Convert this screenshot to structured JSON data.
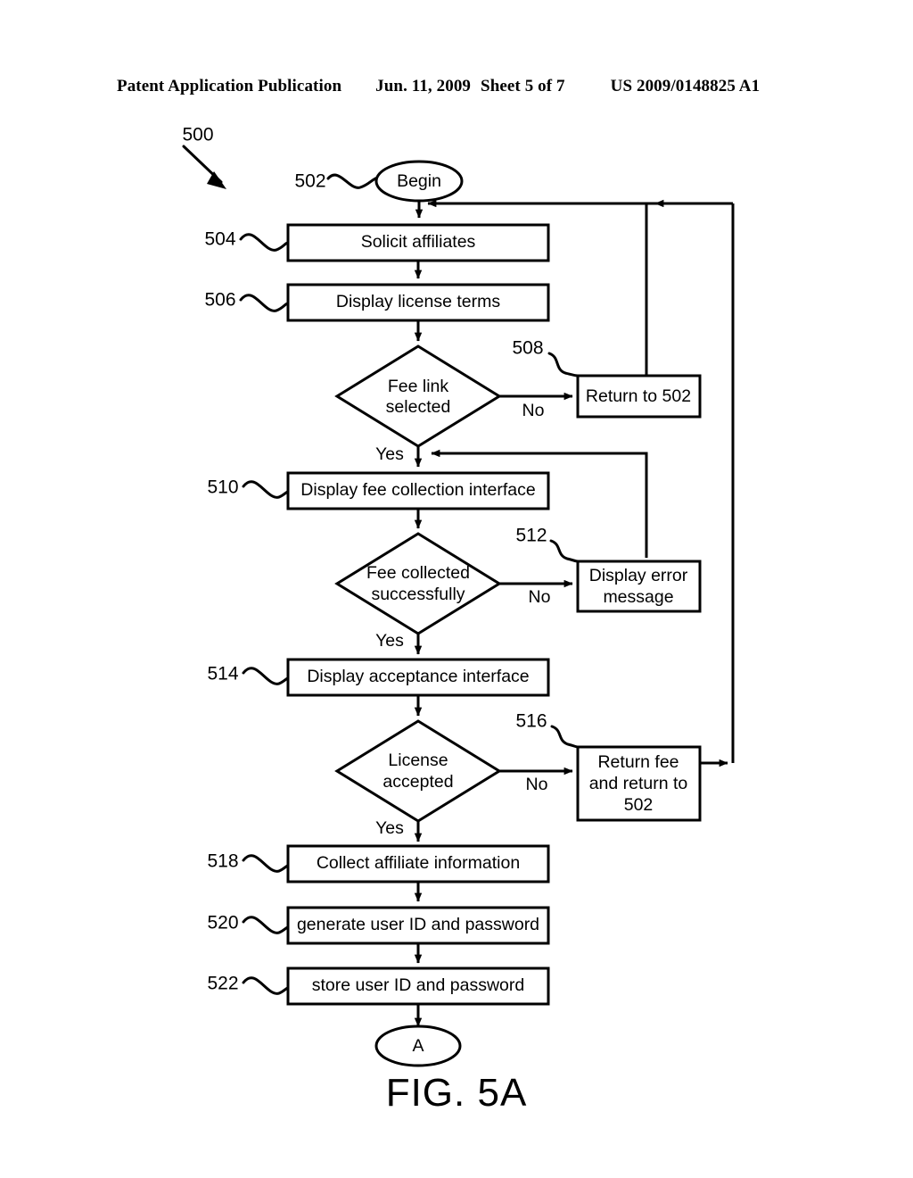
{
  "header": {
    "publication": "Patent Application Publication",
    "date": "Jun. 11, 2009",
    "sheet": "Sheet 5 of 7",
    "patent_number": "US 2009/0148825 A1"
  },
  "figure": {
    "caption": "FIG. 5A",
    "diagram_ref": "500"
  },
  "flowchart": {
    "type": "flowchart",
    "nodes": [
      {
        "id": "n502",
        "ref": "502",
        "shape": "terminator",
        "label": "Begin"
      },
      {
        "id": "n504",
        "ref": "504",
        "shape": "process",
        "label": "Solicit affiliates"
      },
      {
        "id": "n506",
        "ref": "506",
        "shape": "process",
        "label": "Display license terms"
      },
      {
        "id": "d1",
        "ref": "",
        "shape": "decision",
        "label": "Fee link selected",
        "line1": "Fee link",
        "line2": "selected"
      },
      {
        "id": "n508",
        "ref": "508",
        "shape": "process",
        "label": "Return to 502",
        "line1": "Return to 502"
      },
      {
        "id": "n510",
        "ref": "510",
        "shape": "process",
        "label": "Display fee collection interface"
      },
      {
        "id": "d2",
        "ref": "",
        "shape": "decision",
        "label": "Fee collected successfully",
        "line1": "Fee collected",
        "line2": "successfully"
      },
      {
        "id": "n512",
        "ref": "512",
        "shape": "process",
        "label": "Display error message",
        "line1": "Display error",
        "line2": "message"
      },
      {
        "id": "n514",
        "ref": "514",
        "shape": "process",
        "label": "Display acceptance interface"
      },
      {
        "id": "d3",
        "ref": "",
        "shape": "decision",
        "label": "License accepted",
        "line1": "License",
        "line2": "accepted"
      },
      {
        "id": "n516",
        "ref": "516",
        "shape": "process",
        "label": "Return fee and return to 502",
        "line1": "Return fee",
        "line2": "and return to",
        "line3": "502"
      },
      {
        "id": "n518",
        "ref": "518",
        "shape": "process",
        "label": "Collect affiliate information"
      },
      {
        "id": "n520",
        "ref": "520",
        "shape": "process",
        "label": "generate user ID and password"
      },
      {
        "id": "n522",
        "ref": "522",
        "shape": "process",
        "label": "store user ID and password"
      },
      {
        "id": "nA",
        "ref": "",
        "shape": "connector",
        "label": "A"
      }
    ],
    "edges": [
      {
        "from": "n502",
        "to": "n504",
        "label": ""
      },
      {
        "from": "n504",
        "to": "n506",
        "label": ""
      },
      {
        "from": "n506",
        "to": "d1",
        "label": ""
      },
      {
        "from": "d1",
        "to": "n508",
        "label": "No"
      },
      {
        "from": "d1",
        "to": "n510",
        "label": "Yes"
      },
      {
        "from": "n508",
        "to": "n504",
        "label": ""
      },
      {
        "from": "n510",
        "to": "d2",
        "label": ""
      },
      {
        "from": "d2",
        "to": "n512",
        "label": "No"
      },
      {
        "from": "d2",
        "to": "n514",
        "label": "Yes"
      },
      {
        "from": "n512",
        "to": "n510",
        "label": ""
      },
      {
        "from": "n514",
        "to": "d3",
        "label": ""
      },
      {
        "from": "d3",
        "to": "n516",
        "label": "No"
      },
      {
        "from": "d3",
        "to": "n518",
        "label": "Yes"
      },
      {
        "from": "n516",
        "to": "n504",
        "label": ""
      },
      {
        "from": "n518",
        "to": "n520",
        "label": ""
      },
      {
        "from": "n520",
        "to": "n522",
        "label": ""
      },
      {
        "from": "n522",
        "to": "nA",
        "label": ""
      }
    ],
    "branch_labels": {
      "d1_no": "No",
      "d1_yes": "Yes",
      "d2_no": "No",
      "d2_yes": "Yes",
      "d3_no": "No",
      "d3_yes": "Yes"
    }
  },
  "colors": {
    "ink": "#000000",
    "paper": "#ffffff"
  }
}
